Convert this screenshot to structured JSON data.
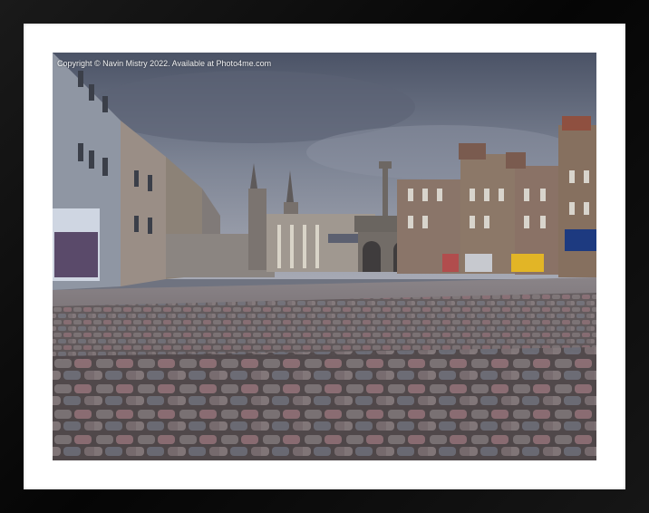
{
  "watermark": {
    "text": "Copyright © Navin Mistry 2022. Available at Photo4me.com"
  },
  "frame": {
    "frame_color": "#0b0b0b",
    "mat_color": "#ffffff"
  },
  "scene": {
    "subject": "cobblestone square with historic granite buildings, clock tower and mercat cross under overcast sky",
    "sky_color": "#7a8090",
    "cobble_color": "#6a6466"
  }
}
